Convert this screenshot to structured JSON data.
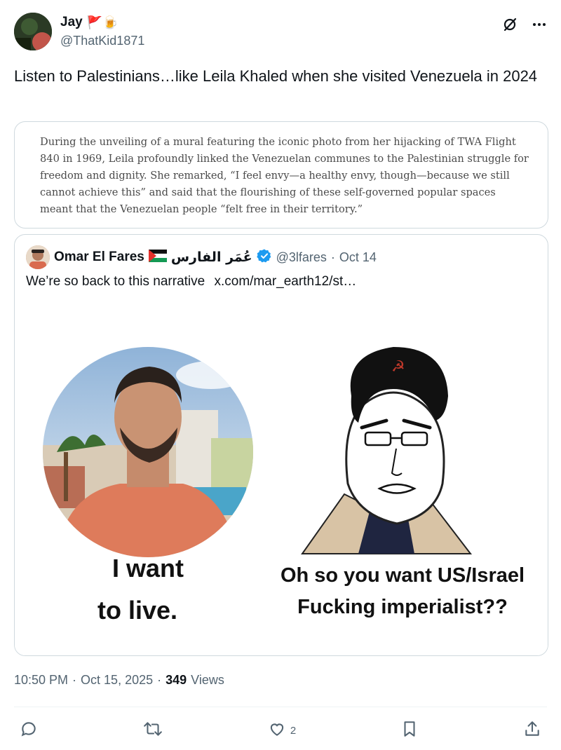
{
  "author": {
    "name": "Jay",
    "emoji": "🚩🍺",
    "handle": "@ThatKid1871"
  },
  "tweet": {
    "text": "Listen to Palestinians…like Leila Khaled when she visited Venezuela in 2024"
  },
  "image_text": {
    "paragraph": "During the unveiling of a mural featuring the iconic photo from her hijacking of TWA Flight 840 in 1969, Leila profoundly linked the Venezuelan communes to the Palestinian struggle for freedom and dignity. She remarked, “I feel envy—a healthy envy, though—because we still cannot achieve this” and said that the flourishing of these self-governed popular spaces meant that the Venezuelan people “felt free in their territory.”"
  },
  "quoted": {
    "name": "Omar El Fares",
    "arabic_name": "عُمَر الفارس",
    "handle": "@3lfares",
    "separator": "·",
    "date": "Oct 14",
    "text": "We’re so back to this narrative",
    "link": "x.com/mar_earth12/st…",
    "meme_left": "I want to live.",
    "meme_left_line1": "I want",
    "meme_left_line2": "to live.",
    "meme_right_line1": "Oh so you want US/Israel",
    "meme_right_line2": "Fucking imperialist??"
  },
  "meta": {
    "time": "10:50 PM",
    "dot1": "·",
    "date": "Oct 15, 2025",
    "dot2": "·",
    "views_count": "349",
    "views_label": "Views"
  },
  "actions": {
    "likes": "2"
  },
  "colors": {
    "text": "#0f1419",
    "muted": "#536471",
    "border": "#cfd9de",
    "verified": "#1d9bf0"
  }
}
